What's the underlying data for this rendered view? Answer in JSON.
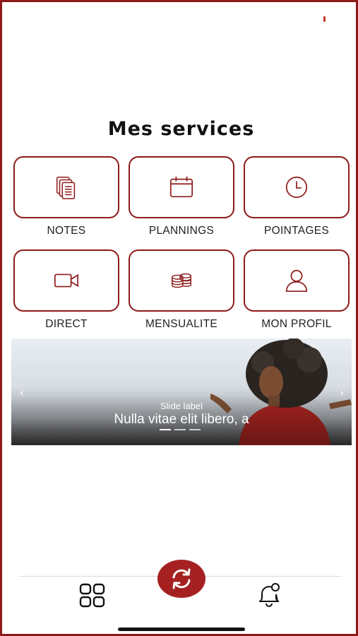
{
  "page": {
    "title": "Mes services"
  },
  "colors": {
    "accent": "#8e1a1a",
    "fab": "#a52121",
    "text": "#111111"
  },
  "services": [
    {
      "label": "NOTES",
      "icon": "documents-icon"
    },
    {
      "label": "PLANNINGS",
      "icon": "calendar-icon"
    },
    {
      "label": "POINTAGES",
      "icon": "clock-icon"
    },
    {
      "label": "DIRECT",
      "icon": "video-camera-icon"
    },
    {
      "label": "MENSUALITE",
      "icon": "coins-icon"
    },
    {
      "label": "MON PROFIL",
      "icon": "user-icon"
    }
  ],
  "carousel": {
    "slide_label": "Slide label",
    "caption": "Nulla vitae elit libero, a",
    "prev_icon": "chevron-left-icon",
    "next_icon": "chevron-right-icon",
    "slides_count": 3,
    "active_slide": 1
  },
  "tabbar": {
    "left_icon": "grid-icon",
    "center_icon": "sync-icon",
    "right_icon": "bell-icon"
  }
}
